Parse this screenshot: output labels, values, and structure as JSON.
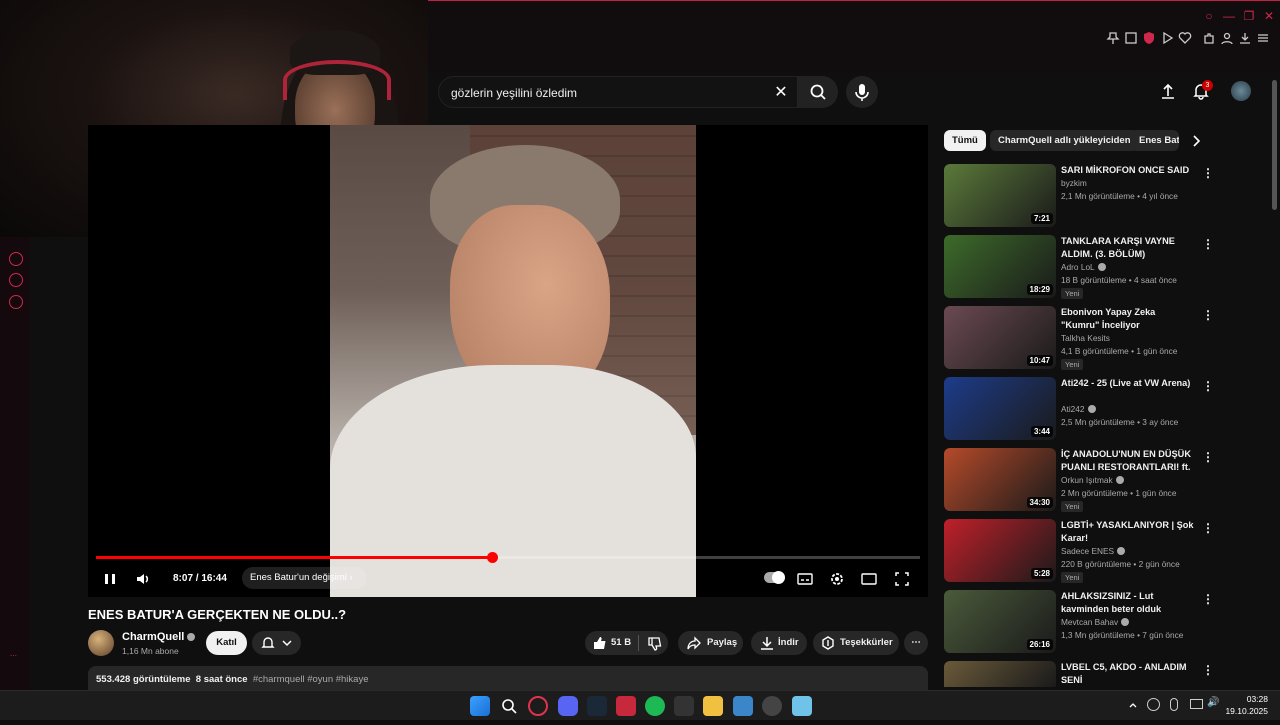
{
  "search": {
    "query": "gözlerin yeşilini özledim"
  },
  "notifications": {
    "count": "3"
  },
  "player": {
    "time": "8:07 / 16:44",
    "chapter": "Enes Batur'un değişimi",
    "progress_fraction": 0.48
  },
  "video": {
    "title": "ENES BATUR'A GERÇEKTEN NE OLDU..?",
    "channel": "CharmQuell",
    "subscribers": "1,16 Mn abone",
    "join_label": "Katıl",
    "likes": "51 B",
    "share_label": "Paylaş",
    "download_label": "İndir",
    "thanks_label": "Teşekkürler",
    "views": "553.428 görüntüleme",
    "age": "8 saat önce",
    "tags": "#charmquell #oyun #hikaye"
  },
  "chips": [
    "Tümü",
    "CharmQuell adlı yükleyiciden",
    "Enes Batur"
  ],
  "recommendations": [
    {
      "title": "SARI MİKROFON ONCE SAID",
      "channel": "byzkim",
      "verified": false,
      "meta": "2,1 Mn görüntüleme • 4 yıl önce",
      "duration": "7:21",
      "badge": "",
      "thumb": "#5b7a3a"
    },
    {
      "title": "TANKLARA KARŞI VAYNE ALDIM. (3. BÖLÜM)",
      "channel": "Adro LoL",
      "verified": true,
      "meta": "18 B görüntüleme • 4 saat önce",
      "duration": "18:29",
      "badge": "Yeni",
      "thumb": "#3d6b2a"
    },
    {
      "title": "Ebonivon Yapay Zeka \"Kumru\" İnceliyor",
      "channel": "Talkha Kesits",
      "verified": false,
      "meta": "4,1 B görüntüleme • 1 gün önce",
      "duration": "10:47",
      "badge": "Yeni",
      "thumb": "#6b4a52"
    },
    {
      "title": "Ati242 - 25 (Live at VW Arena)",
      "channel": "Ati242",
      "verified": true,
      "meta": "2,5 Mn görüntüleme • 3 ay önce",
      "duration": "3:44",
      "badge": "",
      "thumb": "#1d3c8a"
    },
    {
      "title": "İÇ ANADOLU'NUN EN DÜŞÜK PUANLI RESTORANTLARI! ft. ...",
      "channel": "Orkun Işıtmak",
      "verified": true,
      "meta": "2 Mn görüntüleme • 1 gün önce",
      "duration": "34:30",
      "badge": "Yeni",
      "thumb": "#b54a2a"
    },
    {
      "title": "LGBTİ+ YASAKLANIYOR | Şok Karar!",
      "channel": "Sadece ENES",
      "verified": true,
      "meta": "220 B görüntüleme • 2 gün önce",
      "duration": "5:28",
      "badge": "Yeni",
      "thumb": "#c0202a"
    },
    {
      "title": "AHLAKSIZSINIZ - Lut kavminden beter olduk",
      "channel": "Mevtcan Bahav",
      "verified": true,
      "meta": "1,3 Mn görüntüleme • 7 gün önce",
      "duration": "26:16",
      "badge": "",
      "thumb": "#4a5a3a"
    },
    {
      "title": "LVBEL C5, AKDO - ANLADIM SENİ",
      "channel": "",
      "verified": false,
      "meta": "",
      "duration": "",
      "badge": "",
      "thumb": "#6a5a3a"
    }
  ],
  "clock": {
    "time": "03:28",
    "date": "19.10.2025"
  },
  "colors": {
    "accent": "#ff0000",
    "opera": "#d0284c"
  }
}
